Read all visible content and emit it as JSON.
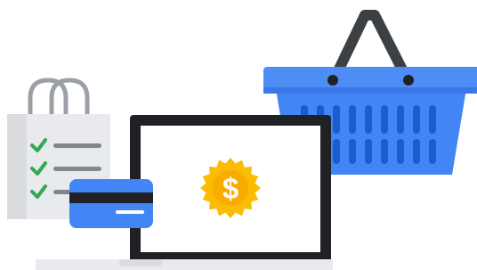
{
  "illustration": {
    "icons": [
      "shopping-basket-icon",
      "shopping-bag-icon",
      "checklist-icon",
      "credit-card-icon",
      "laptop-icon",
      "dollar-badge-icon"
    ],
    "badge_symbol": "$",
    "checklist_items": 3,
    "colors": {
      "basket_blue": "#4285F4",
      "basket_rim": "#4E8DF5",
      "basket_dark": "#1A5DCC",
      "handle_dark": "#3C4043",
      "bag_gray": "#E8EAED",
      "bag_handle": "#9AA0A6",
      "check_green": "#34A853",
      "line_gray": "#80868B",
      "laptop_black": "#202124",
      "screen_white": "#FFFFFF",
      "badge_yellow": "#FBBC04",
      "card_blue": "#4285F4"
    }
  }
}
